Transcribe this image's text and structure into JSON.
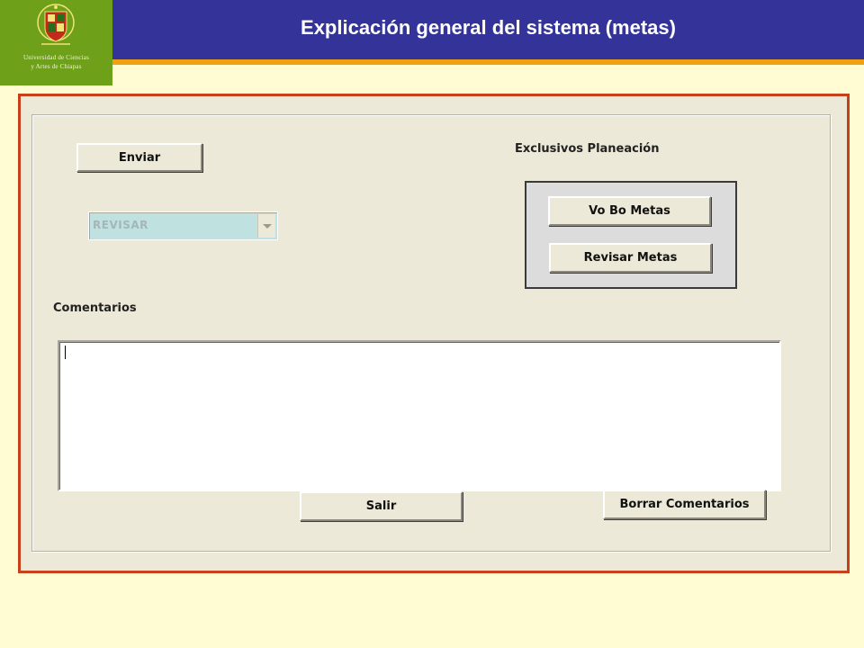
{
  "header": {
    "title": "Explicación general del sistema (metas)",
    "logo_text_line1": "Universidad de Ciencias",
    "logo_text_line2": "y Artes de Chiapas",
    "logo_icon": "university-crest-icon"
  },
  "form": {
    "enviar_label": "Enviar",
    "status_select_value": "REVISAR",
    "planeacion_label": "Exclusivos Planeación",
    "vobo_label": "Vo Bo Metas",
    "revisar_label": "Revisar Metas",
    "comentarios_label": "Comentarios",
    "comentarios_value": "",
    "salir_label": "Salir",
    "borrar_label": "Borrar Comentarios"
  },
  "colors": {
    "title_bar": "#333399",
    "accent_line": "#F0A010",
    "logo_bg": "#6FA01A",
    "frame_border": "#C8401A",
    "form_bg": "#ECE9D8",
    "page_bg": "#FFFBD3",
    "select_bg": "#BFE1E0"
  }
}
